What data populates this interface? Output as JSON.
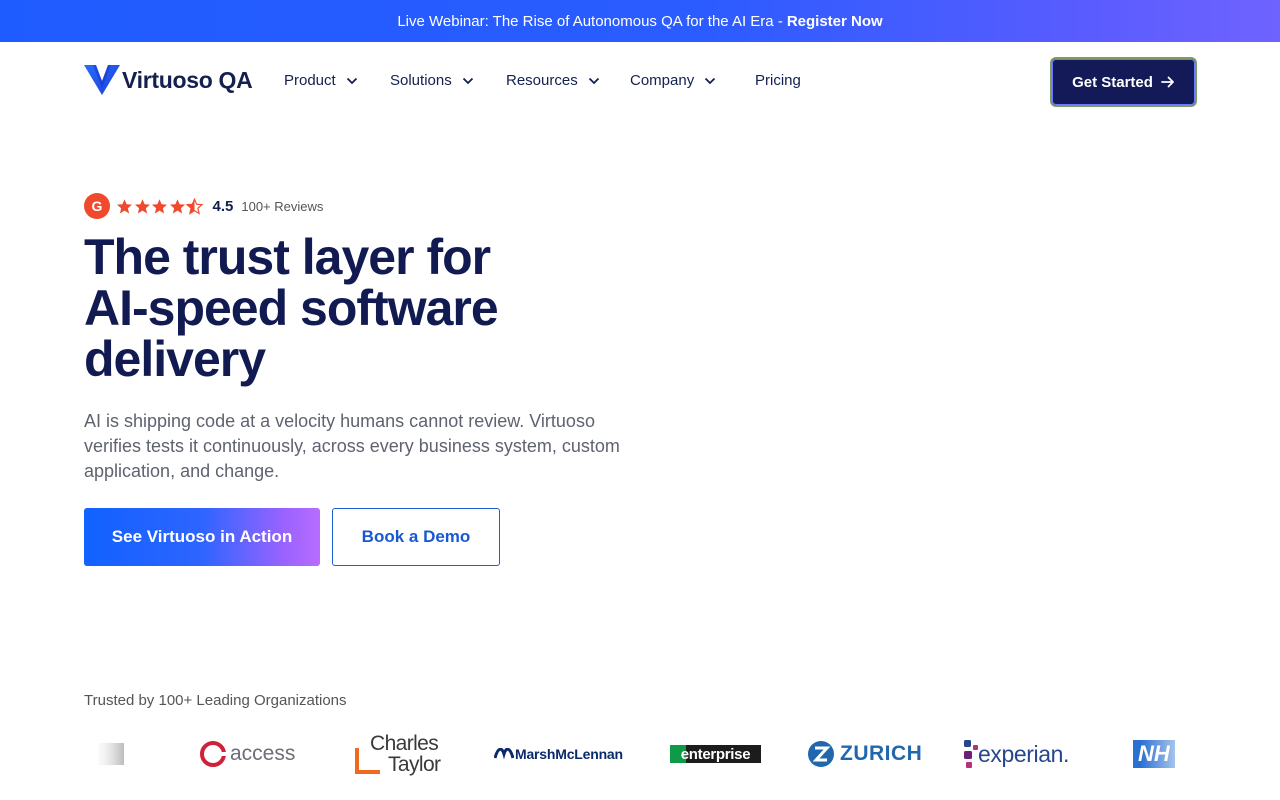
{
  "announcement": {
    "text": "Live Webinar: The Rise of Autonomous QA for the AI Era -",
    "link": "Register Now"
  },
  "nav": {
    "brand": "Virtuoso QA",
    "items": [
      {
        "label": "Product"
      },
      {
        "label": "Solutions"
      },
      {
        "label": "Resources"
      },
      {
        "label": "Company"
      },
      {
        "label": "Pricing"
      }
    ],
    "cta": "Get Started"
  },
  "hero": {
    "rating_badge": "G",
    "rating": "4.5",
    "stars": 4.5,
    "reviews": "100+ Reviews",
    "headline_line1": "The trust layer for",
    "headline_line2": "AI-speed software",
    "headline_line3": "delivery",
    "subtext": "AI is shipping code at a velocity humans cannot review. Virtuoso verifies tests it continuously, across every business system, custom application, and change.",
    "primary_button": "See Virtuoso in Action",
    "secondary_button": "Book a Demo"
  },
  "trusted": {
    "label": "Trusted by 100+ Leading Organizations",
    "logos": [
      {
        "name": "access"
      },
      {
        "name_line1": "Charles",
        "name_line2": "Taylor"
      },
      {
        "name": "MarshMcLennan"
      },
      {
        "name": "enterprise"
      },
      {
        "name": "ZURICH"
      },
      {
        "name": "experian."
      },
      {
        "name": "NH"
      }
    ]
  },
  "colors": {
    "accent": "#1f5cff",
    "heading": "#121a52",
    "star": "#ef4a2e"
  }
}
